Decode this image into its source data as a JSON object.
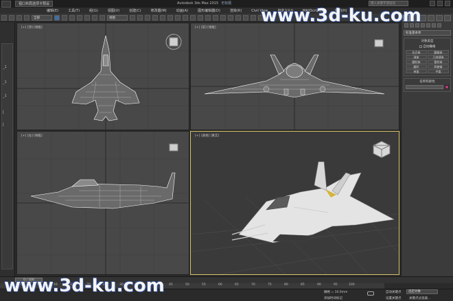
{
  "window": {
    "doc_tab": "视口布局选项卡预设",
    "title": "Autodesk 3ds Max 2015",
    "title_sub": "无标题",
    "search_placeholder": "键入关键字或短语"
  },
  "menu": [
    "编辑(E)",
    "工具(T)",
    "组(G)",
    "视图(V)",
    "创建(C)",
    "修改器(M)",
    "动画(A)",
    "图形编辑器(D)",
    "渲染(R)",
    "Civil View",
    "自定义(U)",
    "MAXScript(X)",
    "帮助(H)"
  ],
  "toolbar": {
    "selection_filter": "全部",
    "view_dropdown": "视图"
  },
  "viewports": {
    "top": "[+] [顶] [线框]",
    "front": "[+] [前] [线框]",
    "left": "[+] [左] [线框]",
    "perspective": "[+] [透视] [真实]"
  },
  "command_panel": {
    "category_dropdown": "标准基本体",
    "object_type_header": "对象类型",
    "autogrid": "自动栅格",
    "objects": [
      "长方体",
      "圆锥体",
      "球体",
      "几何球体",
      "圆柱体",
      "管状体",
      "圆环",
      "四棱锥",
      "茶壶",
      "平面"
    ],
    "name_color_header": "名称和颜色",
    "swatch_color": "#b03a72"
  },
  "timeline": {
    "slider": "0 / 100",
    "ticks": [
      "0",
      "5",
      "10",
      "15",
      "20",
      "25",
      "30",
      "35",
      "40",
      "45",
      "50",
      "55",
      "60",
      "65",
      "70",
      "75",
      "80",
      "85",
      "90",
      "95",
      "100"
    ]
  },
  "status": {
    "grid": "栅格 = 10.0mm",
    "add_time_tag": "添加时间标记",
    "auto_key": "自动关键点",
    "selected_object": "选定对象",
    "set_key": "设置关键点",
    "key_filter": "关键点过滤器..."
  },
  "watermark": {
    "top": "www.3d-ku.com",
    "bottom": "www.3d-ku.com"
  }
}
